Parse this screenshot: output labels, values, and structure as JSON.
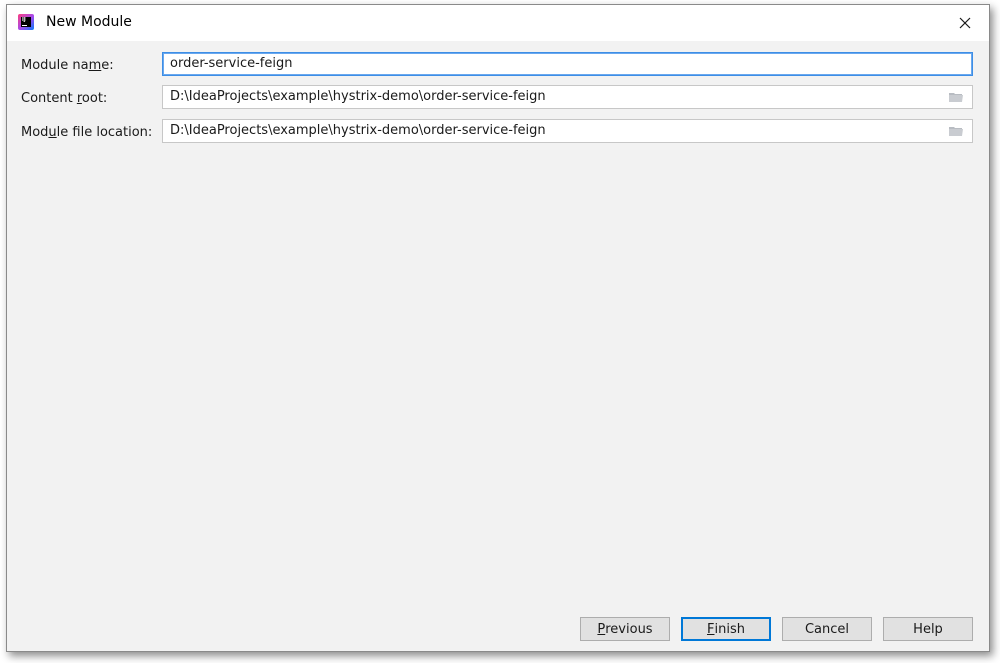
{
  "window": {
    "title": "New Module",
    "close_glyph": "✕",
    "app_icon": "intellij-idea-icon"
  },
  "form": {
    "module_name": {
      "label_pre": "Module na",
      "label_mnemonic": "m",
      "label_post": "e:",
      "value": "order-service-feign"
    },
    "content_root": {
      "label_pre": "Content ",
      "label_mnemonic": "r",
      "label_post": "oot:",
      "value": "D:\\IdeaProjects\\example\\hystrix-demo\\order-service-feign"
    },
    "module_file_location": {
      "label_pre": "Mod",
      "label_mnemonic": "u",
      "label_post": "le file location:",
      "value": "D:\\IdeaProjects\\example\\hystrix-demo\\order-service-feign"
    }
  },
  "buttons": {
    "previous": {
      "mnemonic": "P",
      "rest": "revious"
    },
    "finish": {
      "mnemonic": "F",
      "rest": "inish"
    },
    "cancel": {
      "label": "Cancel"
    },
    "help": {
      "label": "Help"
    }
  },
  "colors": {
    "focus_border": "#3d8ee6",
    "default_button_border": "#0078d7",
    "dialog_background": "#f2f2f2"
  }
}
